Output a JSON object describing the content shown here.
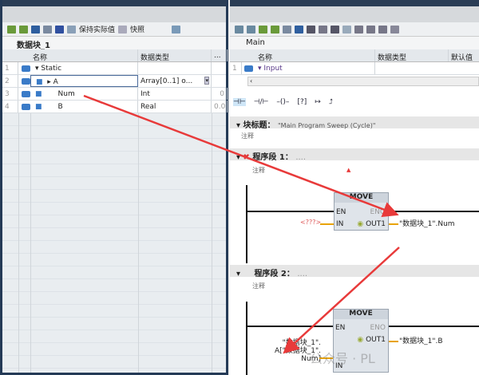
{
  "left": {
    "toolbar": {
      "keep_actual": "保持实际值",
      "snapshot": "快照"
    },
    "block_name": "数据块_1",
    "columns": [
      "名称",
      "数据类型"
    ],
    "col_more": "...",
    "rows": [
      {
        "n": "1",
        "name": "Static",
        "type": "",
        "val": ""
      },
      {
        "n": "2",
        "name": "A",
        "type": "Array[0..1] o...",
        "val": ""
      },
      {
        "n": "3",
        "name": "Num",
        "type": "Int",
        "val": "0"
      },
      {
        "n": "4",
        "name": "B",
        "type": "Real",
        "val": "0.0"
      }
    ]
  },
  "right": {
    "block": "Main",
    "columns": [
      "名称",
      "数据类型",
      "默认值"
    ],
    "rows": [
      {
        "n": "1",
        "name": "Input"
      }
    ],
    "block_title_label": "块标题：",
    "block_title": "\"Main Program Sweep (Cycle)\"",
    "comment": "注释",
    "network1": {
      "label": "程序段 1：",
      "dots": "....",
      "box": "MOVE",
      "en": "EN",
      "eno": "ENO",
      "in": "IN",
      "out": "OUT1",
      "in_val": "<???>",
      "out_val": "\"数据块_1\".Num"
    },
    "network2": {
      "label": "程序段 2：",
      "dots": "....",
      "box": "MOVE",
      "en": "EN",
      "eno": "ENO",
      "in": "IN",
      "out": "OUT1",
      "in_val_1": "\"数据块_1\".",
      "in_val_2": "A[\"数据块_1\".",
      "in_val_3": "Num]",
      "out_val": "\"数据块_1\".B"
    },
    "watermark": "公众号 · PL"
  },
  "colors": {
    "arrow": "#e83a3a",
    "frame": "#243a56",
    "wire_yellow": "#e8a300"
  }
}
